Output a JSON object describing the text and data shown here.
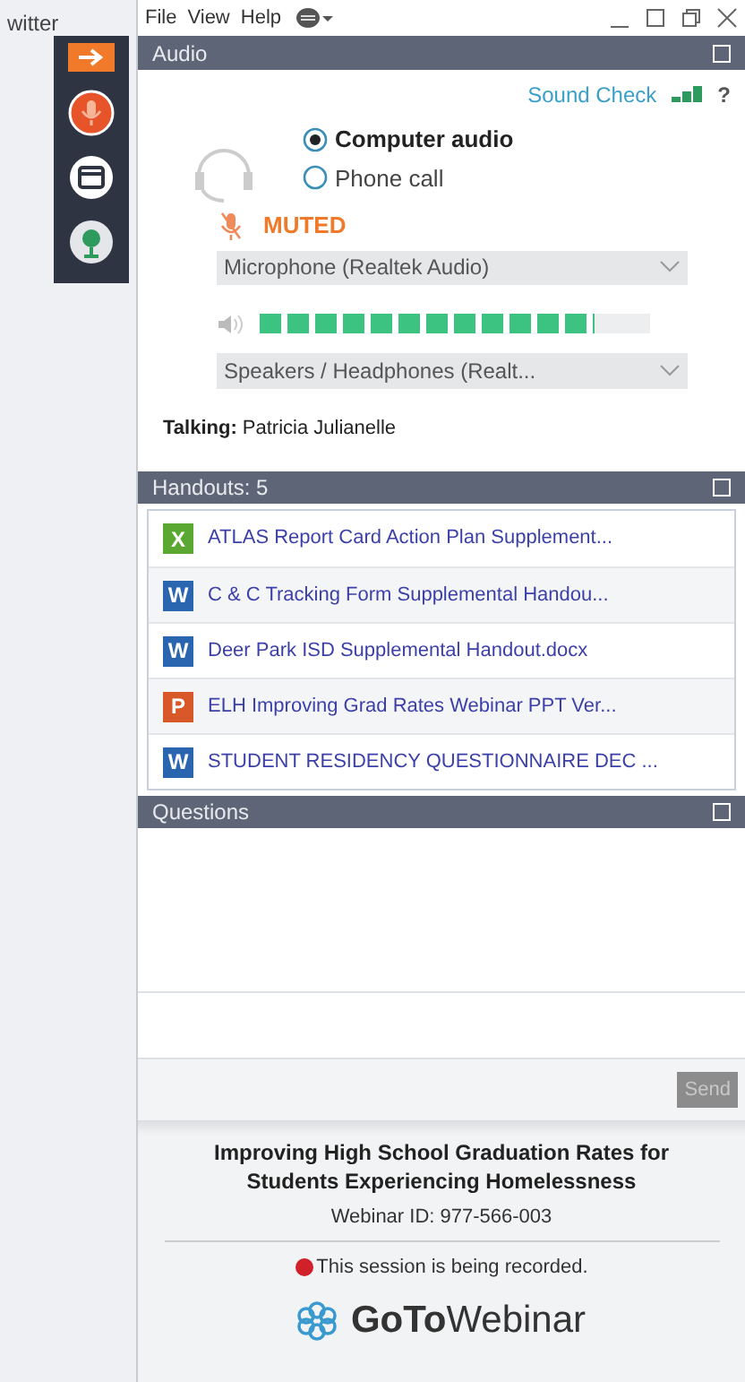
{
  "background_app": {
    "text": "witter"
  },
  "menu": [
    "File",
    "View",
    "Help"
  ],
  "audio": {
    "title": "Audio",
    "sound_check": "Sound Check",
    "help": "?",
    "options": [
      {
        "label": "Computer audio",
        "selected": true
      },
      {
        "label": "Phone call",
        "selected": false
      }
    ],
    "mute_status": "MUTED",
    "microphone": "Microphone (Realtek Audio)",
    "speaker_meter": {
      "level": 0.857
    },
    "speakers": "Speakers / Headphones (Realt...",
    "talking": "**Talking:** Patricia Julianelle"
  },
  "handouts": {
    "title": "Handouts: 5",
    "items": [
      {
        "kind": "excel",
        "letter": "X",
        "name": "ATLAS Report Card Action Plan Supplement..."
      },
      {
        "kind": "word",
        "letter": "W",
        "name": "C & C Tracking Form Supplemental Handou..."
      },
      {
        "kind": "word",
        "letter": "W",
        "name": "Deer Park ISD Supplemental Handout.docx"
      },
      {
        "kind": "powerpoint",
        "letter": "P",
        "name": "ELH Improving Grad Rates Webinar PPT Ver..."
      },
      {
        "kind": "word",
        "letter": "W",
        "name": "STUDENT RESIDENCY QUESTIONNAIRE DEC ..."
      }
    ]
  },
  "questions": {
    "title": "Questions",
    "send": "Send"
  },
  "footer": {
    "title": "Improving High School Graduation Rates for Students Experiencing Homelessness",
    "webinar_id": "Webinar ID: 977-566-003",
    "recording": "This session is being recorded.",
    "logo": "**GoTo**Webinar"
  }
}
